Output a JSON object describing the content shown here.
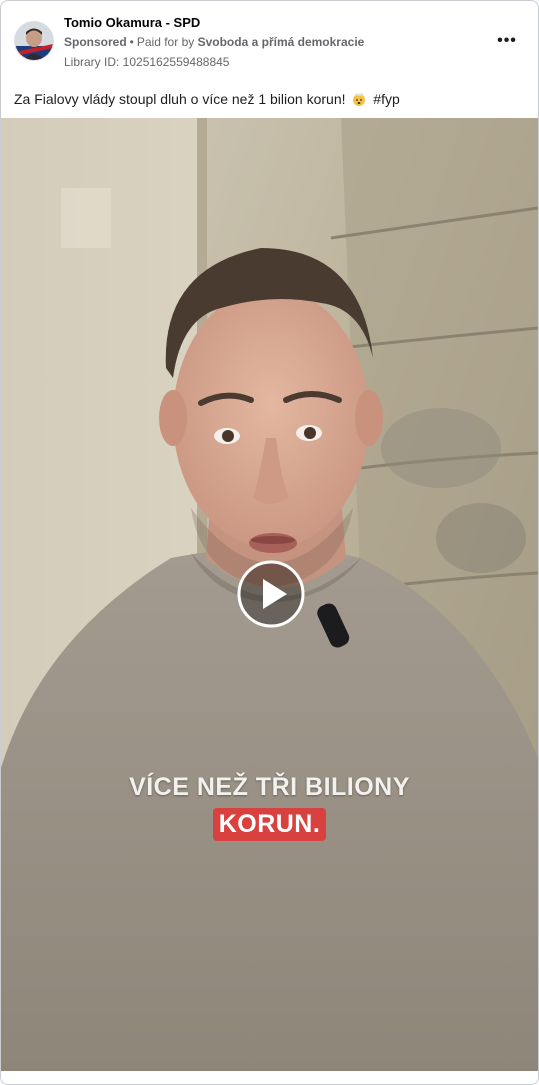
{
  "post": {
    "page_name": "Tomio Okamura - SPD",
    "sponsored_label": "Sponsored",
    "dot": "•",
    "paid_for_by_prefix": "Paid for by",
    "paid_for_by_name": "Svoboda a přímá demokracie",
    "library_id": "Library ID: 1025162559488845",
    "more_icon": "more-horizontal-icon",
    "caption_before_emoji": "Za Fialovy vlády stoupl dluh o více než 1 bilion korun!",
    "caption_emoji": "exploding-head-emoji",
    "caption_hashtag": "#fyp"
  },
  "video": {
    "overlay_line1": "VÍCE NEŽ TŘI BILIONY",
    "overlay_line2": "KORUN.",
    "play_icon": "play-icon",
    "highlight_color": "#d9413f"
  },
  "colors": {
    "border": "#c9ccd1",
    "secondary_text": "#65676b",
    "primary_text": "#1c1e21"
  }
}
